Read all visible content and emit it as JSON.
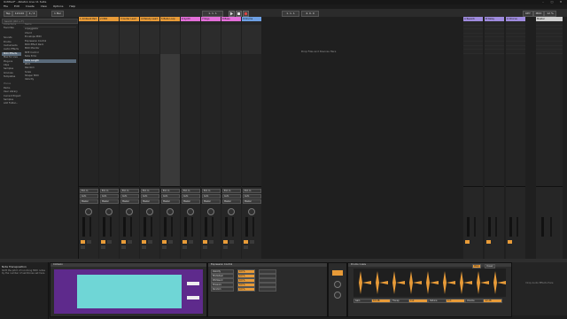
{
  "window": {
    "title": "Untitled* - Ableton Live 11 Suite",
    "controls": [
      "–",
      "□",
      "✕"
    ]
  },
  "menu": [
    "File",
    "Edit",
    "Create",
    "View",
    "Options",
    "Help"
  ],
  "transport": {
    "tap": "Tap",
    "tempo": "120.00",
    "signature": "4 / 4",
    "quantize": "1 Bar",
    "position": "1. 1. 1",
    "loop_start": "1. 1. 1",
    "loop_length": "4. 0. 0",
    "key": "KEY",
    "midi": "MIDI",
    "cpu": "12 %"
  },
  "browser": {
    "search_placeholder": "Search (Ctrl + F)",
    "collections_header": "Collections",
    "categories": [
      "Favorites",
      "Sounds",
      "Drums",
      "Instruments",
      "Audio Effects",
      "MIDI Effects",
      "Max for Live",
      "Plug-ins",
      "Clips",
      "Samples",
      "Grooves",
      "Templates"
    ],
    "places": [
      "Places",
      "Packs",
      "User Library",
      "Current Project",
      "Samples",
      "Add Folder..."
    ],
    "column_header": "Name",
    "items": [
      "Arpeggiator",
      "Chord",
      "Envelope MIDI",
      "Expression Control",
      "MIDI Effect Rack",
      "MIDI Monitor",
      "MPE Control",
      "Note Echo",
      "Note Length",
      "Pitch",
      "Random",
      "Scale",
      "Shaper MIDI",
      "Velocity"
    ],
    "selected_item": "Note Length"
  },
  "tracks": [
    {
      "name": "1 Ambient Pad",
      "color": "#e89b38"
    },
    {
      "name": "2 MIDI",
      "color": "#e89b38"
    },
    {
      "name": "3 Guitar Lead",
      "color": "#e89b38"
    },
    {
      "name": "4 Melody Lead",
      "color": "#e89b38"
    },
    {
      "name": "5 Bells Loop",
      "color": "#e89b38"
    },
    {
      "name": "6 Synth",
      "color": "#e36fd9"
    },
    {
      "name": "7 Keys",
      "color": "#e36fd9"
    },
    {
      "name": "8 Bass",
      "color": "#e36fd9"
    },
    {
      "name": "9 Drums",
      "color": "#6da0e4"
    }
  ],
  "drop_hint": "Drop Files and Devices Here",
  "returns": [
    {
      "name": "A Reverb",
      "color": "#9f8bde"
    },
    {
      "name": "B Delay",
      "color": "#9f8bde"
    },
    {
      "name": "C Chorus",
      "color": "#9f8bde"
    }
  ],
  "master": {
    "name": "Master"
  },
  "mixer": {
    "io_label": "Audio From",
    "io_value": "Ext. In",
    "monitor": [
      "In",
      "Auto",
      "Off"
    ],
    "audio_to": "Master",
    "sends": "Sends",
    "vol": "-inf",
    "master_value": "0"
  },
  "info": {
    "title": "Note Transposition",
    "text": "Shift the pitch of incoming MIDI notes by the number of semitones set here."
  },
  "devices": {
    "collision": {
      "title": "Collision"
    },
    "expression": {
      "title": "Expression Control",
      "rows": [
        "Velocity",
        "Modwheel",
        "Pitchbend",
        "Pressure",
        "Random"
      ],
      "values": [
        "0.0 %",
        "0.0 %",
        "0.0 %",
        "0.0 %",
        "0.0 %"
      ]
    },
    "sampler": {
      "title": "Drums 1.wav",
      "params": [
        "Gain",
        "Transp",
        "Detune",
        "Volume"
      ],
      "values": [
        "0.0 dB",
        "0 st",
        "0 ct",
        "-12 dB"
      ],
      "mode": "Classic",
      "warp": "Warp"
    },
    "hint": "Drop Audio Effects Here"
  }
}
